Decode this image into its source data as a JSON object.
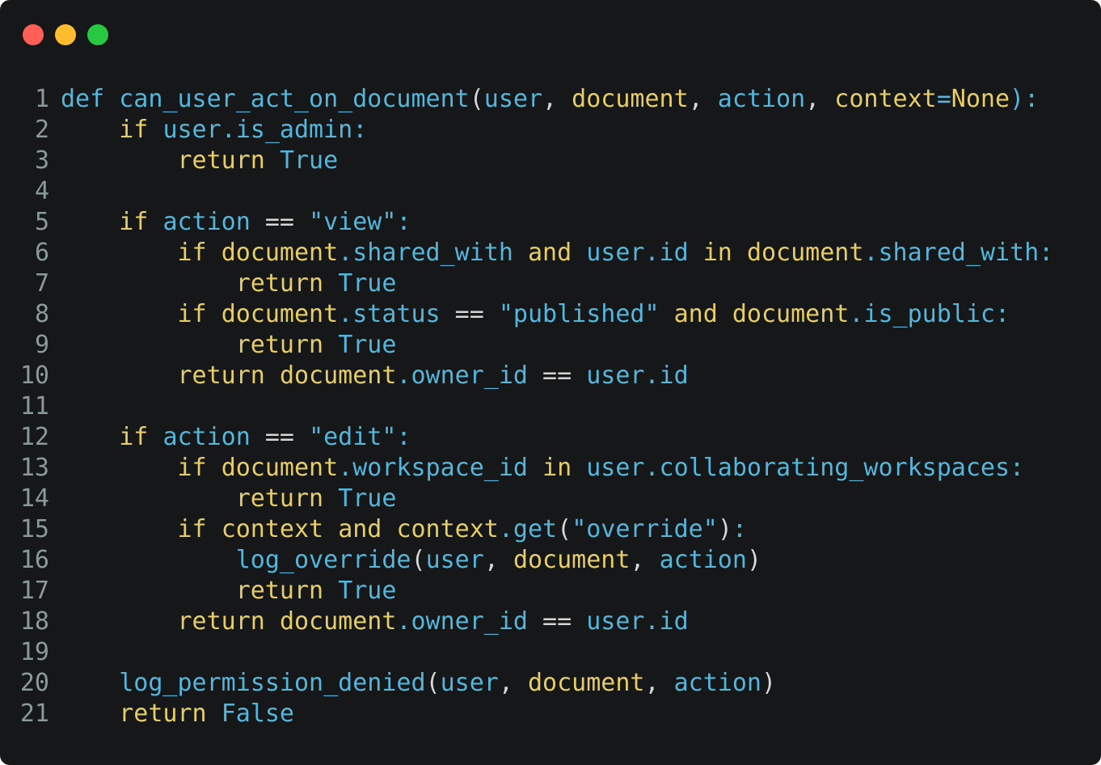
{
  "window": {
    "controls": {
      "close_color": "#ff5f57",
      "minimize_color": "#febc2e",
      "zoom_color": "#28c840"
    }
  },
  "colors": {
    "background": "#151718",
    "keyword": "#e6cd69",
    "identifier": "#55b5db",
    "white": "#d6d6d6",
    "param": "#e6cd69",
    "line_number": "#8a9a9a"
  },
  "code": {
    "language": "python",
    "lines": [
      {
        "n": "1",
        "tokens": [
          [
            "def ",
            "identifier"
          ],
          [
            "can_user_act_on_document",
            "identifier"
          ],
          [
            "(",
            "white"
          ],
          [
            "user",
            "identifier"
          ],
          [
            ", ",
            "white"
          ],
          [
            "document",
            "keyword"
          ],
          [
            ", ",
            "white"
          ],
          [
            "action",
            "identifier"
          ],
          [
            ", ",
            "white"
          ],
          [
            "context",
            "keyword"
          ],
          [
            "=",
            "identifier"
          ],
          [
            "None",
            "keyword"
          ],
          [
            "):",
            "identifier"
          ]
        ]
      },
      {
        "n": "2",
        "tokens": [
          [
            "    ",
            "white"
          ],
          [
            "if ",
            "keyword"
          ],
          [
            "user",
            "identifier"
          ],
          [
            ".is_admin:",
            "identifier"
          ]
        ]
      },
      {
        "n": "3",
        "tokens": [
          [
            "        ",
            "white"
          ],
          [
            "return ",
            "keyword"
          ],
          [
            "True",
            "identifier"
          ]
        ]
      },
      {
        "n": "4",
        "tokens": []
      },
      {
        "n": "5",
        "tokens": [
          [
            "    ",
            "white"
          ],
          [
            "if ",
            "keyword"
          ],
          [
            "action",
            "identifier"
          ],
          [
            " == ",
            "white"
          ],
          [
            "\"view\"",
            "identifier"
          ],
          [
            ":",
            "identifier"
          ]
        ]
      },
      {
        "n": "6",
        "tokens": [
          [
            "        ",
            "white"
          ],
          [
            "if ",
            "keyword"
          ],
          [
            "document",
            "keyword"
          ],
          [
            ".shared_with ",
            "identifier"
          ],
          [
            "and ",
            "keyword"
          ],
          [
            "user",
            "identifier"
          ],
          [
            ".id ",
            "identifier"
          ],
          [
            "in ",
            "keyword"
          ],
          [
            "document",
            "keyword"
          ],
          [
            ".shared_with:",
            "identifier"
          ]
        ]
      },
      {
        "n": "7",
        "tokens": [
          [
            "            ",
            "white"
          ],
          [
            "return ",
            "keyword"
          ],
          [
            "True",
            "identifier"
          ]
        ]
      },
      {
        "n": "8",
        "tokens": [
          [
            "        ",
            "white"
          ],
          [
            "if ",
            "keyword"
          ],
          [
            "document",
            "keyword"
          ],
          [
            ".status",
            "identifier"
          ],
          [
            " == ",
            "white"
          ],
          [
            "\"published\"",
            "identifier"
          ],
          [
            " and ",
            "keyword"
          ],
          [
            "document",
            "keyword"
          ],
          [
            ".is_public:",
            "identifier"
          ]
        ]
      },
      {
        "n": "9",
        "tokens": [
          [
            "            ",
            "white"
          ],
          [
            "return ",
            "keyword"
          ],
          [
            "True",
            "identifier"
          ]
        ]
      },
      {
        "n": "10",
        "tokens": [
          [
            "        ",
            "white"
          ],
          [
            "return ",
            "keyword"
          ],
          [
            "document",
            "keyword"
          ],
          [
            ".owner_id",
            "identifier"
          ],
          [
            " == ",
            "white"
          ],
          [
            "user",
            "identifier"
          ],
          [
            ".id",
            "identifier"
          ]
        ]
      },
      {
        "n": "11",
        "tokens": []
      },
      {
        "n": "12",
        "tokens": [
          [
            "    ",
            "white"
          ],
          [
            "if ",
            "keyword"
          ],
          [
            "action",
            "identifier"
          ],
          [
            " == ",
            "white"
          ],
          [
            "\"edit\"",
            "identifier"
          ],
          [
            ":",
            "identifier"
          ]
        ]
      },
      {
        "n": "13",
        "tokens": [
          [
            "        ",
            "white"
          ],
          [
            "if ",
            "keyword"
          ],
          [
            "document",
            "keyword"
          ],
          [
            ".workspace_id ",
            "identifier"
          ],
          [
            "in ",
            "keyword"
          ],
          [
            "user",
            "identifier"
          ],
          [
            ".collaborating_workspaces:",
            "identifier"
          ]
        ]
      },
      {
        "n": "14",
        "tokens": [
          [
            "            ",
            "white"
          ],
          [
            "return ",
            "keyword"
          ],
          [
            "True",
            "identifier"
          ]
        ]
      },
      {
        "n": "15",
        "tokens": [
          [
            "        ",
            "white"
          ],
          [
            "if ",
            "keyword"
          ],
          [
            "context ",
            "keyword"
          ],
          [
            "and ",
            "keyword"
          ],
          [
            "context",
            "keyword"
          ],
          [
            ".get",
            "identifier"
          ],
          [
            "(",
            "white"
          ],
          [
            "\"override\"",
            "identifier"
          ],
          [
            ")",
            "white"
          ],
          [
            ":",
            "identifier"
          ]
        ]
      },
      {
        "n": "16",
        "tokens": [
          [
            "            ",
            "white"
          ],
          [
            "log_override",
            "identifier"
          ],
          [
            "(",
            "white"
          ],
          [
            "user",
            "identifier"
          ],
          [
            ", ",
            "white"
          ],
          [
            "document",
            "keyword"
          ],
          [
            ", ",
            "white"
          ],
          [
            "action",
            "identifier"
          ],
          [
            ")",
            "white"
          ]
        ]
      },
      {
        "n": "17",
        "tokens": [
          [
            "            ",
            "white"
          ],
          [
            "return ",
            "keyword"
          ],
          [
            "True",
            "identifier"
          ]
        ]
      },
      {
        "n": "18",
        "tokens": [
          [
            "        ",
            "white"
          ],
          [
            "return ",
            "keyword"
          ],
          [
            "document",
            "keyword"
          ],
          [
            ".owner_id",
            "identifier"
          ],
          [
            " == ",
            "white"
          ],
          [
            "user",
            "identifier"
          ],
          [
            ".id",
            "identifier"
          ]
        ]
      },
      {
        "n": "19",
        "tokens": []
      },
      {
        "n": "20",
        "tokens": [
          [
            "    ",
            "white"
          ],
          [
            "log_permission_denied",
            "identifier"
          ],
          [
            "(",
            "white"
          ],
          [
            "user",
            "identifier"
          ],
          [
            ", ",
            "white"
          ],
          [
            "document",
            "keyword"
          ],
          [
            ", ",
            "white"
          ],
          [
            "action",
            "identifier"
          ],
          [
            ")",
            "white"
          ]
        ]
      },
      {
        "n": "21",
        "tokens": [
          [
            "    ",
            "white"
          ],
          [
            "return ",
            "keyword"
          ],
          [
            "False",
            "identifier"
          ]
        ]
      }
    ]
  }
}
